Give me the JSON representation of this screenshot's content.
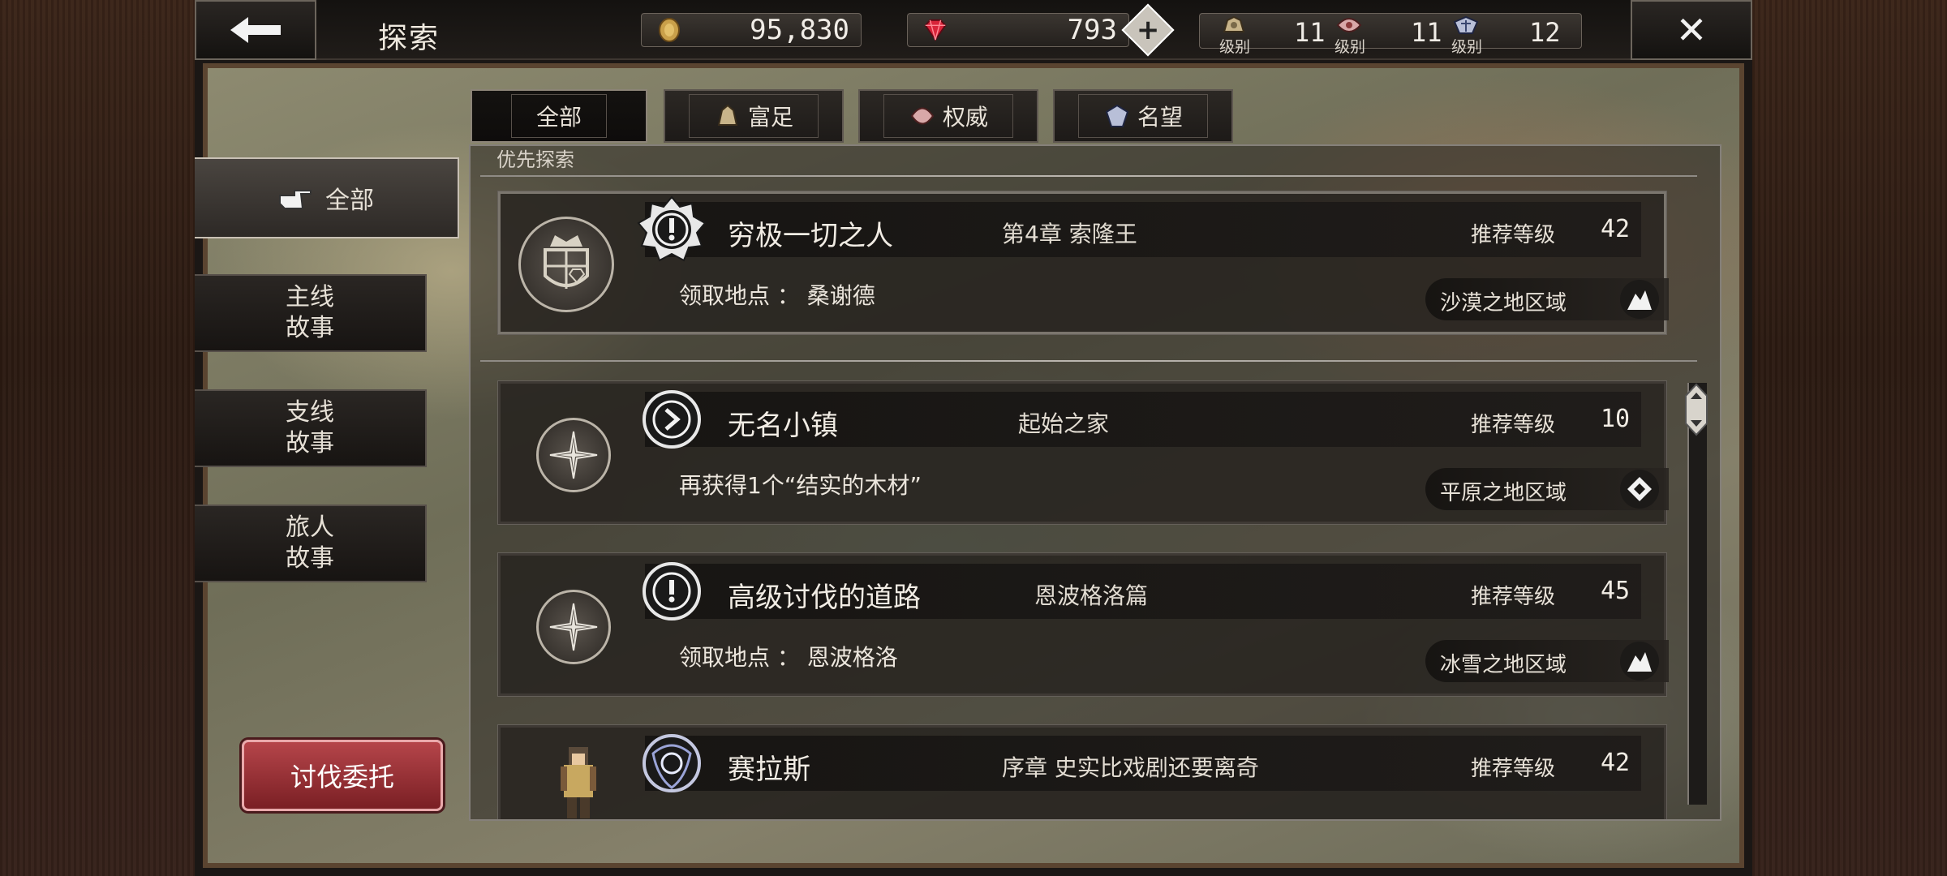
{
  "header": {
    "title": "探索",
    "coins": "95,830",
    "gems": "793",
    "ranks": [
      {
        "name": "富足",
        "label": "级别",
        "value": "11"
      },
      {
        "name": "权威",
        "label": "级别",
        "value": "11"
      },
      {
        "name": "名望",
        "label": "级别",
        "value": "12"
      }
    ]
  },
  "tabs": [
    {
      "label": "全部",
      "active": true
    },
    {
      "label": "富足"
    },
    {
      "label": "权威"
    },
    {
      "label": "名望"
    }
  ],
  "sidebar": {
    "items": [
      {
        "label": "全部",
        "active": true
      },
      {
        "line1": "主线",
        "line2": "故事"
      },
      {
        "line1": "支线",
        "line2": "故事"
      },
      {
        "line1": "旅人",
        "line2": "故事"
      }
    ],
    "hunt_button": "讨伐委托"
  },
  "list": {
    "priority_label": "优先探索",
    "rec_label": "推荐等级",
    "quests": [
      {
        "title": "穷极一切之人",
        "chapter": "第4章  索隆王",
        "level": "42",
        "sub": "领取地点 ： 桑谢德",
        "region": "沙漠之地区域",
        "badge": "exclamation-badge-icon"
      },
      {
        "title": "无名小镇",
        "chapter": "起始之家",
        "level": "10",
        "sub": "再获得1个“结实的木材”",
        "region": "平原之地区域",
        "badge": "arrow-badge-icon"
      },
      {
        "title": "高级讨伐的道路",
        "chapter": "恩波格洛篇",
        "level": "45",
        "sub": "领取地点 ： 恩波格洛",
        "region": "冰雪之地区域",
        "badge": "exclamation-badge-icon"
      },
      {
        "title": "赛拉斯",
        "chapter": "序章  史实比戏剧还要离奇",
        "level": "42",
        "badge": "traveler-badge-icon"
      }
    ]
  },
  "colors": {
    "hunt_button": "#9a3136",
    "panel_border": "#85807a"
  }
}
